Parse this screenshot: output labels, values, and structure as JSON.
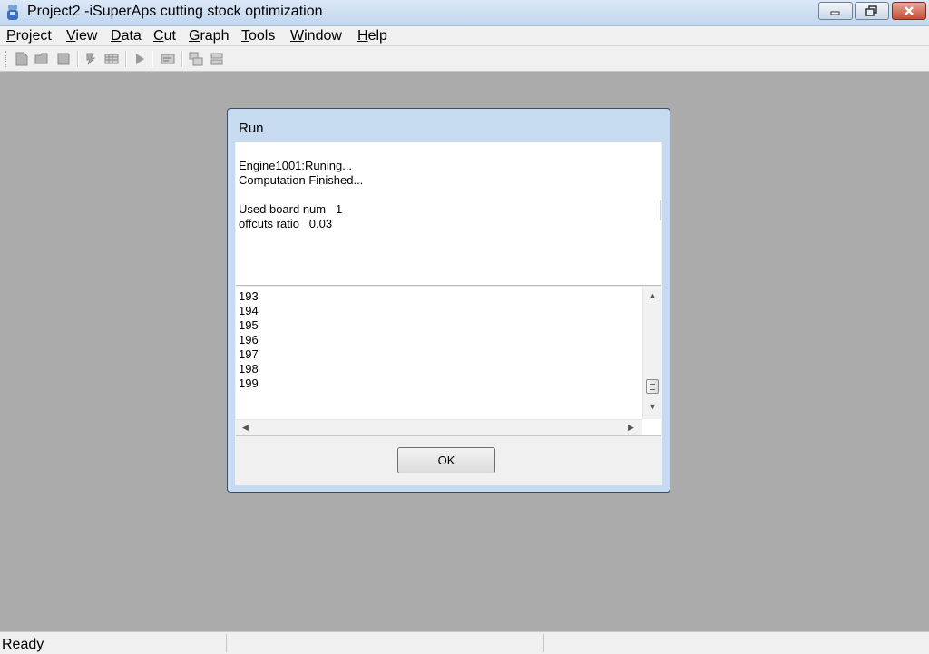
{
  "window": {
    "title": "Project2 -iSuperAps cutting stock optimization",
    "app_icon": "app-icon",
    "controls": [
      "minimize-icon",
      "restore-icon",
      "close-icon"
    ]
  },
  "menu": {
    "items": [
      {
        "label": "Project"
      },
      {
        "label": "View"
      },
      {
        "label": "Data"
      },
      {
        "label": "Cut"
      },
      {
        "label": "Graph"
      },
      {
        "label": "Tools"
      },
      {
        "label": "Window"
      },
      {
        "label": "Help"
      }
    ]
  },
  "toolbar": {
    "icons": [
      "new-icon",
      "open-icon",
      "save-icon",
      "settings-icon",
      "table-icon",
      "run-icon",
      "report-icon",
      "cascade-icon",
      "tile-icon"
    ]
  },
  "dialog": {
    "title": "Run",
    "log_lines": [
      "Engine1001:Runing...",
      "Computation Finished...",
      "",
      "Used board num   1",
      "offcuts ratio   0.03"
    ],
    "list_items": [
      "193",
      "194",
      "195",
      "196",
      "197",
      "198",
      "199"
    ],
    "ok_label": "OK"
  },
  "statusbar": {
    "text": "Ready"
  },
  "colors": {
    "workspace": "#ababab",
    "dialog_frame": "#c7dbf0",
    "titlebar": "#c2d6ee"
  }
}
